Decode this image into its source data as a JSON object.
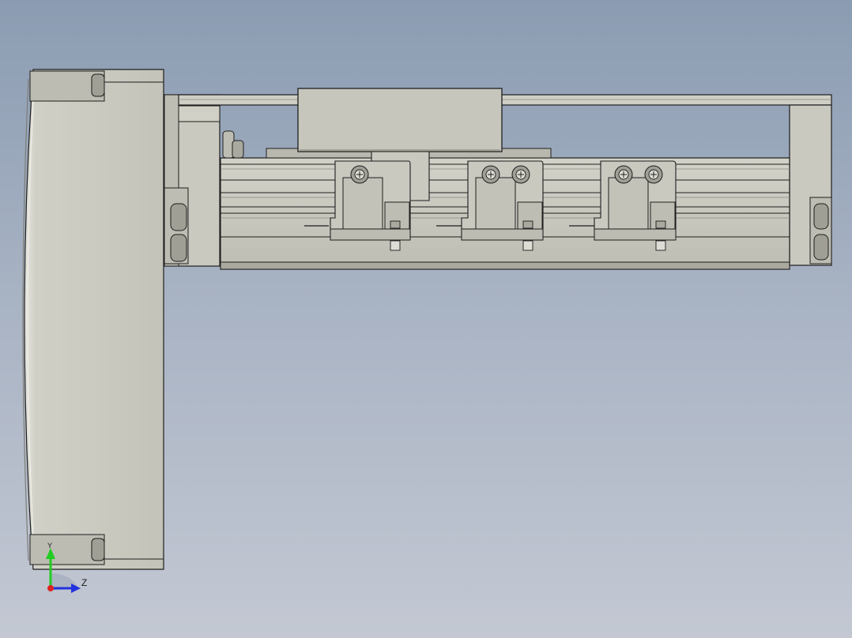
{
  "viewport": {
    "background_top": "#8b9cb2",
    "background_bottom": "#c3c8d3"
  },
  "model": {
    "body_color": "#c6c6bc",
    "edge_color": "#1e1e1e",
    "shadow_color": "#9e9e94",
    "carriage_count": 3
  },
  "triad": {
    "y_axis_label": "Y",
    "z_axis_label": "Z",
    "y_axis_color": "#22cc22",
    "z_axis_color": "#2233dd",
    "origin_color": "#dd2222",
    "icons": [
      "y-axis-arrow-icon",
      "z-axis-arrow-icon",
      "origin-dot-icon"
    ]
  }
}
